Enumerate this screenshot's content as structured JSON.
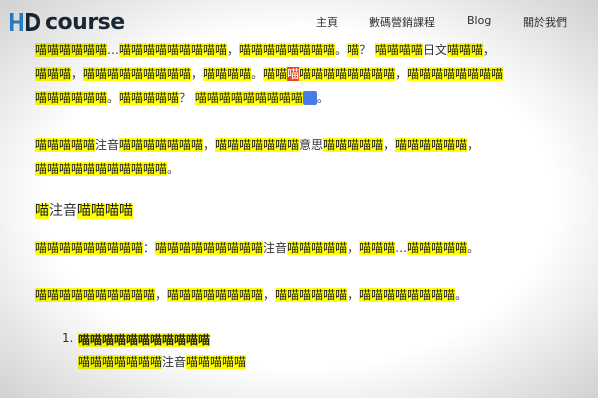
{
  "header": {
    "logo_text": "course",
    "nav": [
      "主頁",
      "數碼營銷課程",
      "Blog",
      "關於我們"
    ]
  },
  "para1": {
    "line1": {
      "a": "喵喵喵喵喵喵",
      "b": "…",
      "c": "喵喵喵喵喵喵喵喵喵",
      "d": "，",
      "e": "喵喵喵喵喵喵喵喵",
      "f": "。",
      "g": "喵",
      "h": "？ ",
      "i": "喵喵喵喵",
      "j": "日文",
      "k": "喵喵喵",
      "l": "，"
    },
    "line2": {
      "a": "喵喵喵",
      "b": "，",
      "c": "喵喵喵喵喵喵喵喵喵",
      "d": "，",
      "e": "喵喵喵喵",
      "f": "。",
      "g": "喵喵",
      "h": "喵",
      "i": "喵喵喵喵喵喵喵喵",
      "j": "，",
      "k": "喵喵喵喵喵喵喵喵"
    },
    "line3": {
      "a": "喵喵喵喵喵喵",
      "b": "。",
      "c": "喵喵喵喵喵",
      "d": "？ ",
      "e": "喵喵喵喵喵喵喵喵喵",
      "f": "。"
    }
  },
  "para2": {
    "line1": {
      "a": "喵喵喵喵喵",
      "b": "注音",
      "c": "喵喵喵喵喵喵喵",
      "d": "，",
      "e": "喵喵喵喵喵喵喵",
      "f": "意思",
      "g": "喵喵喵喵喵",
      "h": "，",
      "i": "喵喵喵喵喵喵",
      "j": "，"
    },
    "line2": {
      "a": "喵喵喵喵喵喵喵喵喵喵喵",
      "b": "。"
    }
  },
  "heading": {
    "a": "喵",
    "b": "注音",
    "c": "喵喵喵喵"
  },
  "para3": {
    "a": "喵喵喵喵喵喵喵喵喵",
    "b": "：",
    "c": "喵喵喵喵喵喵喵喵喵",
    "d": "注音",
    "e": "喵喵喵喵喵",
    "f": "，",
    "g": "喵喵喵",
    "h": "…",
    "i": "喵喵喵喵喵",
    "j": "。"
  },
  "para4": {
    "a": "喵喵喵喵喵喵喵喵喵喵",
    "b": "，",
    "c": "喵喵喵喵喵喵喵喵",
    "d": "，",
    "e": "喵喵喵喵喵喵",
    "f": "，",
    "g": "喵喵喵喵喵喵喵喵",
    "h": "。"
  },
  "list": {
    "num": "1.",
    "item1": "喵喵喵喵喵喵喵喵喵喵喵",
    "item2": {
      "a": "喵喵喵喵喵喵喵",
      "b": "注音",
      "c": "喵喵喵喵喵"
    }
  }
}
